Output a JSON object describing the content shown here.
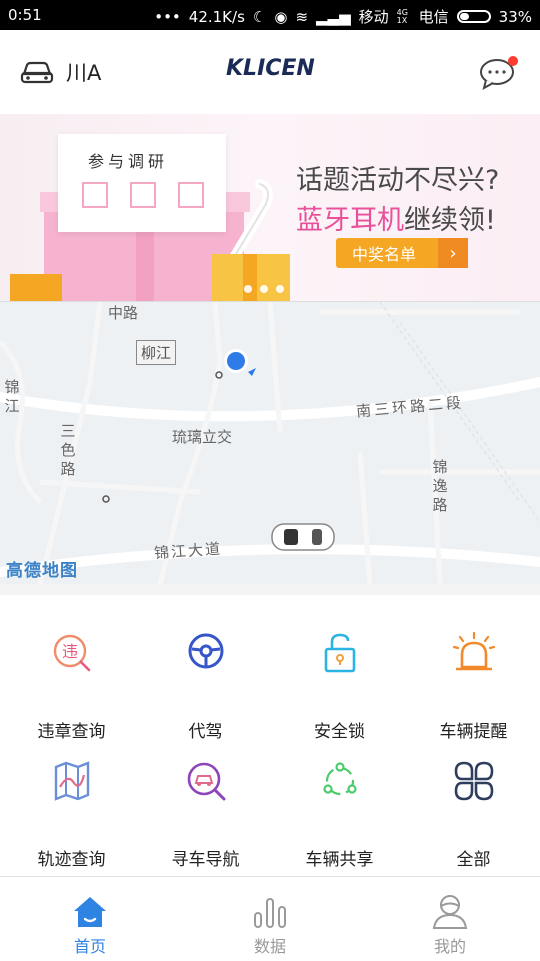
{
  "status_bar": {
    "time": "0:51",
    "dots": "•••",
    "speed": "42.1K/s",
    "carrier1": "移动",
    "carrier2": "电信",
    "network_small": "4G 1X",
    "battery": "33%"
  },
  "header": {
    "plate": "川A",
    "brand": "KLICEN",
    "car_icon": "car-icon",
    "message_icon": "chat-bubble-icon",
    "notification_color": "#ff3b30"
  },
  "banner": {
    "paper_text": "参与调研",
    "headline1": "话题活动不尽兴?",
    "headline2_pink": "蓝牙耳机",
    "headline2_rest": "继续领!",
    "button_label": "中奖名单",
    "button_arrow": "›",
    "slide_count": 3
  },
  "map": {
    "district": "柳江",
    "roads": {
      "nansanhuan": "南三环路二段",
      "liulichangjiao": "琉璃立交",
      "jinjiangdadao": "锦江大道",
      "sanse": "三色路",
      "jinyi": "锦逸路",
      "jin": "锦江",
      "top_road": "中路"
    },
    "provider": "高德地图",
    "location_color": "#2f7be8"
  },
  "grid": {
    "items": [
      {
        "label": "违章查询",
        "icon": "violation-icon"
      },
      {
        "label": "代驾",
        "icon": "steering-wheel-icon"
      },
      {
        "label": "安全锁",
        "icon": "unlock-icon"
      },
      {
        "label": "车辆提醒",
        "icon": "alarm-light-icon"
      },
      {
        "label": "轨迹查询",
        "icon": "route-map-icon"
      },
      {
        "label": "寻车导航",
        "icon": "car-search-icon"
      },
      {
        "label": "车辆共享",
        "icon": "share-icon"
      },
      {
        "label": "全部",
        "icon": "all-apps-icon"
      }
    ]
  },
  "bottom_nav": {
    "tabs": [
      {
        "label": "首页",
        "icon": "home-icon",
        "active": true
      },
      {
        "label": "数据",
        "icon": "bar-chart-icon",
        "active": false
      },
      {
        "label": "我的",
        "icon": "user-icon",
        "active": false
      }
    ],
    "active_color": "#2f84e3"
  }
}
